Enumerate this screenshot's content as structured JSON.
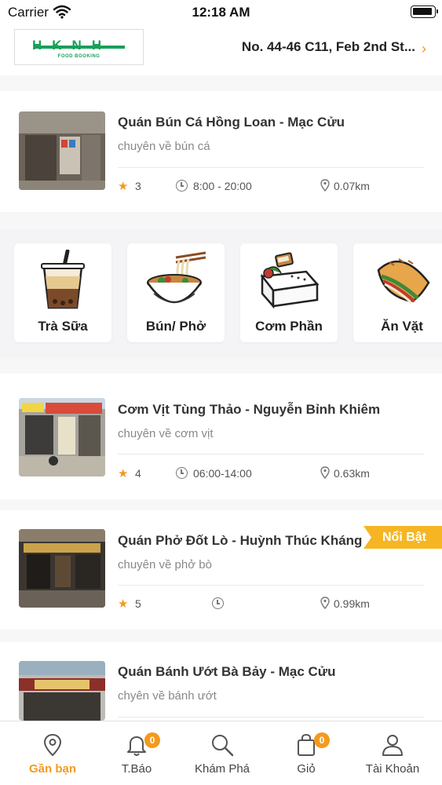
{
  "status_bar": {
    "carrier": "Carrier",
    "time": "12:18 AM"
  },
  "header": {
    "logo": {
      "wordmark": "HKNH",
      "subtitle": "FOOD BOOKING"
    },
    "address": "No. 44-46 C11, Feb 2nd St...",
    "address_chevron": "›"
  },
  "shops": [
    {
      "name": "Quán Bún Cá Hồng Loan - Mạc Cửu",
      "specialty": "chuyên về bún cá",
      "rating": "3",
      "hours": "8:00 - 20:00",
      "distance": "0.07km"
    },
    {
      "name": "Cơm Vịt Tùng Thảo - Nguyễn Bỉnh Khiêm",
      "specialty": "chuyên về cơm vịt",
      "rating": "4",
      "hours": "06:00-14:00",
      "distance": "0.63km"
    },
    {
      "name": "Quán Phở Đốt Lò - Huỳnh Thúc Kháng",
      "specialty": "chuyên về phở bò",
      "rating": "5",
      "hours": "",
      "distance": "0.99km",
      "badge": "Nổi Bật"
    },
    {
      "name": "Quán Bánh Ướt Bà Bảy - Mạc Cửu",
      "specialty": "chyên về bánh ướt"
    }
  ],
  "categories": [
    {
      "label": "Trà Sữa",
      "icon": "milk-tea-icon"
    },
    {
      "label": "Bún/ Phở",
      "icon": "noodle-bowl-icon"
    },
    {
      "label": "Cơm Phần",
      "icon": "rice-box-icon"
    },
    {
      "label": "Ăn Vặt",
      "icon": "banh-mi-icon"
    }
  ],
  "tab_bar": {
    "items": [
      {
        "label": "Gần bạn",
        "icon": "location-pin-icon",
        "active": true
      },
      {
        "label": "T.Báo",
        "icon": "bell-icon",
        "badge": "0"
      },
      {
        "label": "Khám Phá",
        "icon": "search-icon"
      },
      {
        "label": "Giỏ",
        "icon": "shopping-bag-icon",
        "badge": "0"
      },
      {
        "label": "Tài Khoản",
        "icon": "user-icon"
      }
    ]
  },
  "colors": {
    "accent": "#f39a1e",
    "featured": "#f6b623",
    "brand_green": "#18a05a"
  }
}
